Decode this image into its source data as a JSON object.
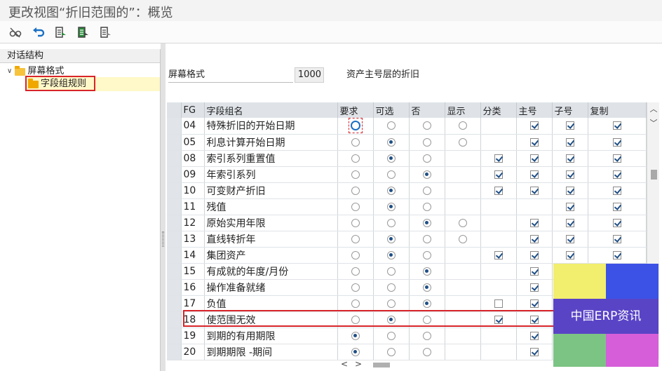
{
  "window": {
    "title": "更改视图“折旧范围的”：概览"
  },
  "toolbar": {
    "buttons": [
      {
        "icon": "glasses-icon"
      },
      {
        "icon": "undo-icon"
      },
      {
        "icon": "select-all-icon"
      },
      {
        "icon": "select-block-icon"
      },
      {
        "icon": "deselect-icon"
      }
    ]
  },
  "tree": {
    "header": "对话结构",
    "root": {
      "label": "屏幕格式",
      "icon": "folder-open-icon"
    },
    "child": {
      "label": "字段组规则",
      "icon": "folder-icon",
      "selected": true
    }
  },
  "form": {
    "screen_format_label": "屏幕格式",
    "screen_format_value": "1000",
    "screen_format_desc": "资产主号层的折旧"
  },
  "table": {
    "headers": [
      "FG",
      "字段组名",
      "要求",
      "可选",
      "否",
      "显示",
      "分类",
      "主号",
      "子号",
      "复制"
    ],
    "rows": [
      {
        "fg": "04",
        "name": "特殊折旧的开始日期",
        "radio": "req",
        "disp": false,
        "cls": null,
        "main": true,
        "sub": true,
        "copy": true
      },
      {
        "fg": "05",
        "name": "利息计算开始日期",
        "radio": "opt",
        "disp": false,
        "cls": null,
        "main": true,
        "sub": true,
        "copy": true
      },
      {
        "fg": "08",
        "name": "索引系列重置值",
        "radio": "opt",
        "disp": null,
        "cls": true,
        "main": true,
        "sub": true,
        "copy": true
      },
      {
        "fg": "09",
        "name": "年索引系列",
        "radio": "no",
        "disp": null,
        "cls": true,
        "main": true,
        "sub": true,
        "copy": true
      },
      {
        "fg": "10",
        "name": "可变财产折旧",
        "radio": "opt",
        "disp": null,
        "cls": true,
        "main": true,
        "sub": true,
        "copy": true
      },
      {
        "fg": "11",
        "name": "残值",
        "radio": "opt",
        "disp": null,
        "cls": null,
        "main": null,
        "sub": true,
        "copy": true
      },
      {
        "fg": "12",
        "name": "原始实用年限",
        "radio": "no",
        "disp": false,
        "cls": null,
        "main": true,
        "sub": true,
        "copy": true
      },
      {
        "fg": "13",
        "name": "直线转折年",
        "radio": "opt",
        "disp": false,
        "cls": null,
        "main": true,
        "sub": true,
        "copy": true
      },
      {
        "fg": "14",
        "name": "集团资产",
        "radio": "opt",
        "disp": null,
        "cls": true,
        "main": true,
        "sub": true,
        "copy": true
      },
      {
        "fg": "15",
        "name": "有成就的年度/月份",
        "radio": "no",
        "disp": null,
        "cls": null,
        "main": true,
        "sub": null,
        "copy": null
      },
      {
        "fg": "16",
        "name": "操作准备就绪",
        "radio": "no",
        "disp": null,
        "cls": null,
        "main": true,
        "sub": null,
        "copy": null
      },
      {
        "fg": "17",
        "name": "负值",
        "radio": "no",
        "disp": null,
        "cls": false,
        "main": true,
        "sub": null,
        "copy": null
      },
      {
        "fg": "18",
        "name": "使范围无效",
        "radio": "opt",
        "disp": null,
        "cls": true,
        "main": true,
        "sub": null,
        "copy": null
      },
      {
        "fg": "19",
        "name": "到期的有用期限",
        "radio": "req",
        "disp": null,
        "cls": null,
        "main": true,
        "sub": null,
        "copy": null
      },
      {
        "fg": "20",
        "name": "到期期限 -期间",
        "radio": "req",
        "disp": null,
        "cls": null,
        "main": true,
        "sub": null,
        "copy": null
      }
    ]
  },
  "watermark": {
    "text": "中国ERP资讯",
    "colors": [
      "#f2ee6e",
      "#3c52e6",
      "#5a44c6",
      "#7cc484",
      "#d65fd9"
    ]
  },
  "colors": {
    "highlight": "#d8242a",
    "accent": "#1f4f86"
  }
}
